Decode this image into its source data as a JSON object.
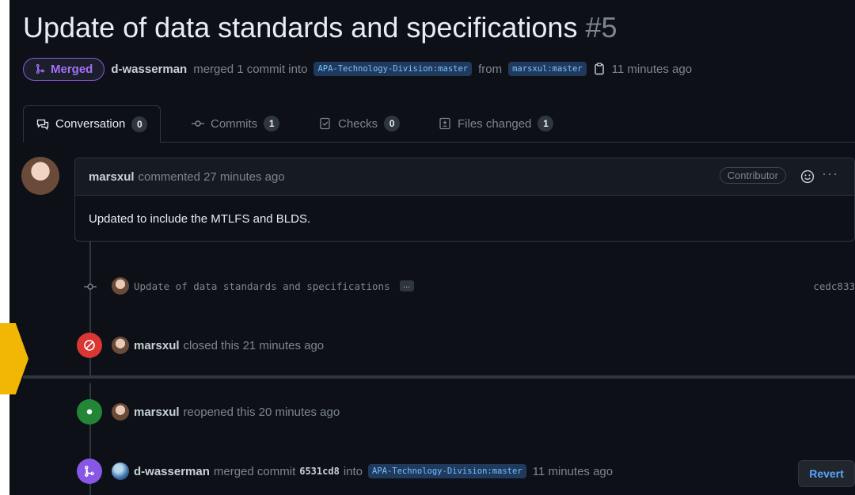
{
  "pr": {
    "title": "Update of data standards and specifications",
    "number": "#5",
    "state_label": "Merged",
    "merger": "d-wasserman",
    "merged_text": "merged 1 commit into",
    "base_branch": "APA-Technology-Division:master",
    "from_text": "from",
    "head_branch": "marsxul:master",
    "merged_time": "11 minutes ago"
  },
  "tabs": [
    {
      "label": "Conversation",
      "count": "0"
    },
    {
      "label": "Commits",
      "count": "1"
    },
    {
      "label": "Checks",
      "count": "0"
    },
    {
      "label": "Files changed",
      "count": "1"
    }
  ],
  "comment": {
    "author": "marsxul",
    "meta": "commented 27 minutes ago",
    "role": "Contributor",
    "body": "Updated to include the MTLFS and BLDS."
  },
  "commit_event": {
    "message": "Update of data standards and specifications",
    "ellipsis": "…",
    "sha": "cedc833"
  },
  "closed_event": {
    "author": "marsxul",
    "text": "closed this 21 minutes ago"
  },
  "reopened_event": {
    "author": "marsxul",
    "text": "reopened this 20 minutes ago"
  },
  "merged_event": {
    "author": "d-wasserman",
    "text_before": "merged commit",
    "commit": "6531cd8",
    "text_into": "into",
    "branch": "APA-Technology-Division:master",
    "time": "11 minutes ago",
    "revert_label": "Revert"
  },
  "colors": {
    "merged_purple": "#8957e5",
    "closed_red": "#da3633",
    "open_green": "#238636",
    "link_blue": "#58a6ff",
    "annotation_arrow": "#f2b705"
  }
}
